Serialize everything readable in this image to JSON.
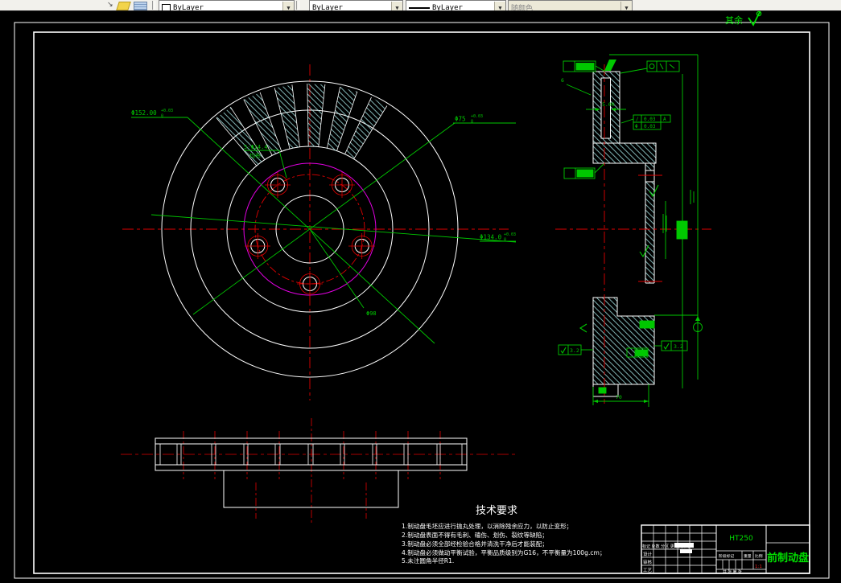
{
  "toolbar": {
    "color_layer": "ByLayer",
    "linetype": "ByLayer",
    "lineweight": "ByLayer",
    "plot_style": "随颜色"
  },
  "notes": {
    "rest": "其余"
  },
  "dims": {
    "d152_v": "Φ152.00",
    "d152_up": "+0.03",
    "d152_low": "0",
    "d75_v": "Φ75",
    "d75_up": "+0.03",
    "d75_low": "0",
    "d134_v": "Φ134.0",
    "d134_up": "+0.03",
    "d134_low": "0",
    "holes_l1": "5-Φ14.4",
    "holes_l2": "均布",
    "d98": "Φ98",
    "vent_gap": "5.00",
    "plate_t": "6",
    "hub_w": "70"
  },
  "fcf": {
    "r1_sym": "/",
    "r1_val": "0.03",
    "r1_datum": "A",
    "r2_sym": "Φ",
    "r2_val": "0.03"
  },
  "roughness": {
    "left": "3.2",
    "right": "3.2"
  },
  "tech_req": {
    "title": "技术要求",
    "items": [
      "1.制动盘毛坯应进行抛丸处理，以消除残余应力，以防止变形；",
      "2.制动盘表面不得有毛刺、磕伤、划伤、裂纹等缺陷；",
      "3.制动盘必须全部经检验合格并清洗干净后才能装配；",
      "4.制动盘必须做动平衡试验，平衡品质级别为G16，不平衡量为100g.cm；",
      "5.未注圆角半径R1."
    ]
  },
  "title_block": {
    "material": "HT250",
    "part_name": "前制动盘",
    "mark_row": "标记 处数 分区 更改文件号",
    "design": "设计",
    "check": "审核",
    "process": "工艺",
    "stage": "阶段标记",
    "weight": "重量",
    "scale": "比例",
    "scale_value": "1:1",
    "sheet": "共 张 第 张"
  }
}
